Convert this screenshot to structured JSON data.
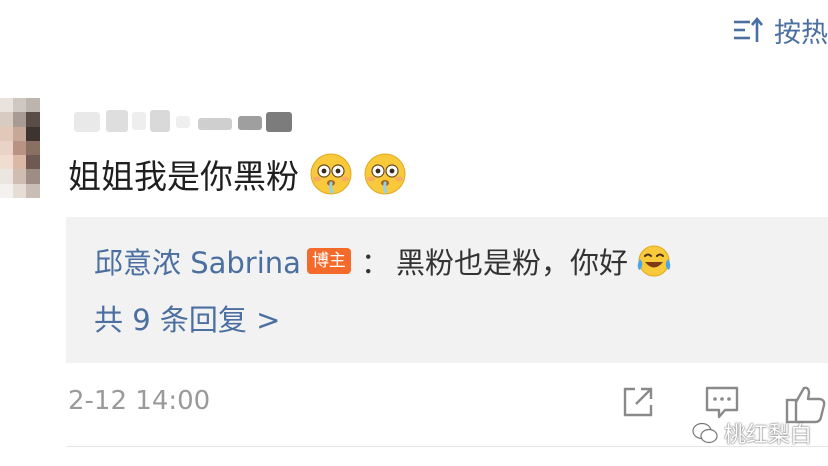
{
  "header": {
    "sort_label": "按热"
  },
  "comment": {
    "text": "姐姐我是你黑粉",
    "timestamp": "2-12 14:00",
    "emoji_icons": [
      "flushed-face-icon",
      "flushed-face-icon"
    ]
  },
  "reply_preview": {
    "author": "邱意浓 Sabrina",
    "author_badge": "博主",
    "separator": "：",
    "text": "黑粉也是粉，你好",
    "emoji_icon": "laughing-tears-icon",
    "more_replies_label": "共 9 条回复 >"
  },
  "actions": {
    "icons": [
      "share-icon",
      "reply-icon",
      "like-icon"
    ]
  },
  "watermark": {
    "label": "桃红梨白"
  },
  "colors": {
    "link_blue": "#4a6fa0",
    "badge_orange": "#f36a2a",
    "reply_background": "#f2f2f2",
    "timestamp_gray": "#9a9a9a"
  }
}
